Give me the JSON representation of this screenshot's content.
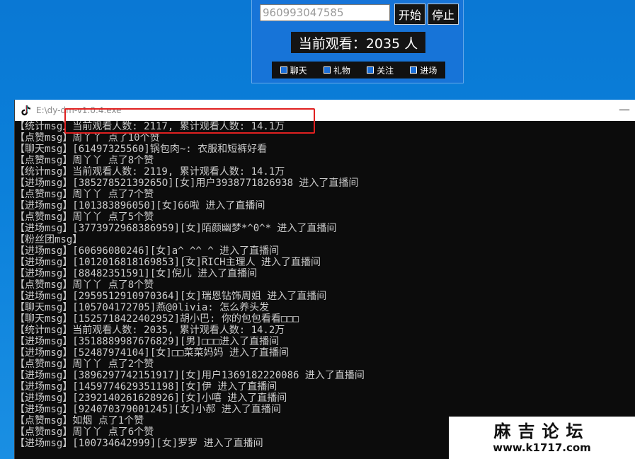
{
  "control_panel": {
    "room_id_value": "960993047585",
    "start_label": "开始",
    "stop_label": "停止",
    "viewer_label": "当前观看：2035 人",
    "filters": [
      {
        "label": "聊天",
        "checked": true
      },
      {
        "label": "礼物",
        "checked": true
      },
      {
        "label": "关注",
        "checked": true
      },
      {
        "label": "进场",
        "checked": true
      }
    ]
  },
  "console_window": {
    "title": "E:\\dy-dm-v1.0.4.exe",
    "icon": "tiktok-icon",
    "minimize_glyph": "—",
    "lines": [
      "【统计msg】当前观看人数: 2117, 累计观看人数: 14.1万",
      "【点赞msg】周丫丫 点了10个赞",
      "【聊天msg】[61497325560]锅包肉~: 衣服和短裤好看",
      "【点赞msg】周丫丫 点了8个赞",
      "【统计msg】当前观看人数: 2119, 累计观看人数: 14.1万",
      "【进场msg】[38527852139265O][女]用户3938771826938 进入了直播间",
      "【点赞msg】周丫丫 点了7个赞",
      "【进场msg】[101383896050][女]66啦 进入了直播间",
      "【点赞msg】周丫丫 点了5个赞",
      "【进场msg】[3773972968386959][女]陌颜幽梦*^0^* 进入了直播间",
      "【粉丝团msg】",
      "【进场msg】[60696080246][女]a^_^^_^ 进入了直播间",
      "【进场msg】[1012016818169853][女]RICH主理人 进入了直播间",
      "【进场msg】[88482351591][女]倪儿 进入了直播间",
      "【点赞msg】周丫丫 点了8个赞",
      "【进场msg】[2959512910970364][女]瑞恩钻饰周姐 进入了直播间",
      "【聊天msg】[105704172705]燕@0livia: 怎么养头发",
      "【聊天msg】[1525718422402952]胡小巴: 你的包包看看□□□",
      "【统计msg】当前观看人数: 2035, 累计观看人数: 14.2万",
      "【进场msg】[3518889987676829][男]□□□进入了直播间",
      "【进场msg】[52487974104][女]□□菜菜妈妈 进入了直播间",
      "【点赞msg】周丫丫 点了2个赞",
      "【进场msg】[3896297742151917][女]用户1369182220086 进入了直播间",
      "【进场msg】[1459774629351198][女]伊 进入了直播间",
      "【进场msg】[2392140261628926][女]小嘻 进入了直播间",
      "【进场msg】[924070379001245][女]小郝 进入了直播间",
      "【点赞msg】如烟 点了1个赞",
      "【点赞msg】周丫丫 点了6个赞",
      "【进场msg】[100734642999][女]罗罗 进入了直播间"
    ]
  },
  "watermark": {
    "title": "麻吉论坛",
    "url": "www.k1717.com"
  },
  "colors": {
    "desktop": "#0b80da",
    "highlight": "#e02020",
    "console_bg": "#0c0c0c",
    "console_text": "#cccccc"
  }
}
